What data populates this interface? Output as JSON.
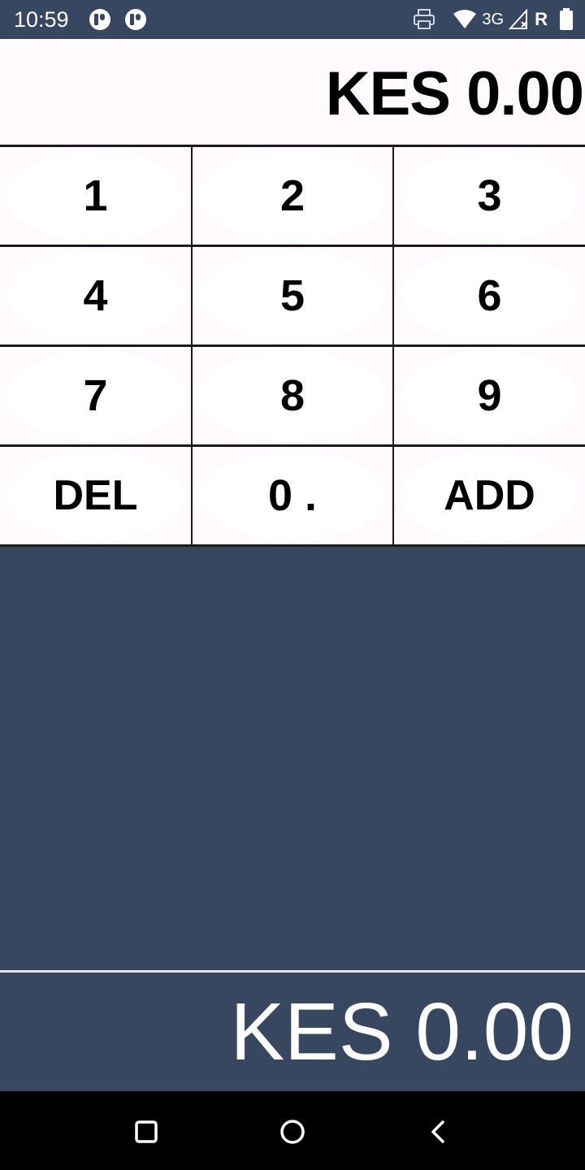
{
  "status_bar": {
    "time": "10:59",
    "notification_icons": [
      "app-notification-icon",
      "app-notification-icon"
    ],
    "network_type": "3G",
    "roaming": "R",
    "icons": [
      "printer-icon",
      "wifi-icon",
      "cell-signal-icon",
      "battery-icon"
    ]
  },
  "amount": {
    "text": "KES 0.00"
  },
  "keypad": {
    "keys": [
      "1",
      "2",
      "3",
      "4",
      "5",
      "6",
      "7",
      "8",
      "9",
      "DEL",
      "0 .",
      "ADD"
    ]
  },
  "total": {
    "text": "KES 0.00"
  },
  "nav_bar": {
    "icons": [
      "recents-square-icon",
      "home-circle-icon",
      "back-chevron-icon"
    ]
  },
  "colors": {
    "header_background": "#36475f",
    "keypad_background": "#fffafd",
    "grid_lines": "#1a1a1a",
    "nav_background": "#000000"
  }
}
